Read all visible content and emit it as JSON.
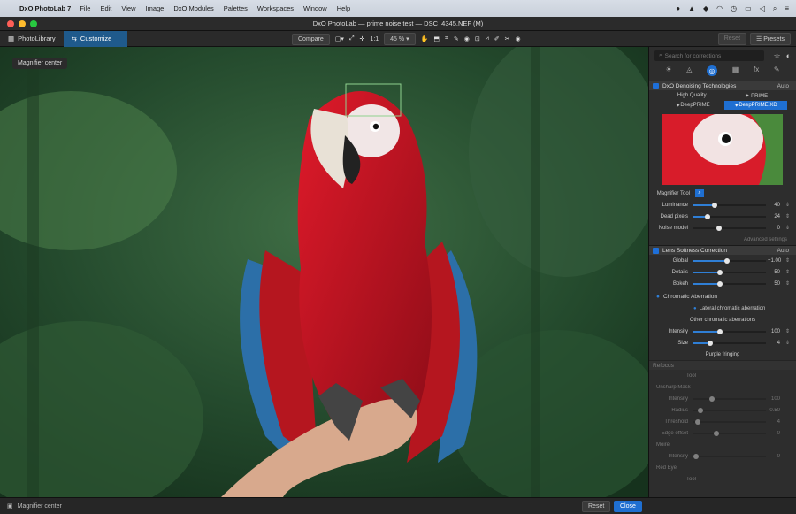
{
  "menubar": {
    "app": "DxO PhotoLab 7",
    "items": [
      "File",
      "Edit",
      "View",
      "Image",
      "DxO Modules",
      "Palettes",
      "Workspaces",
      "Window",
      "Help"
    ]
  },
  "window": {
    "title": "DxO PhotoLab — prime noise test — DSC_4345.NEF (M)"
  },
  "tabs": {
    "library": "PhotoLibrary",
    "customize": "Customize"
  },
  "toolbar": {
    "compare": "Compare",
    "ratio": "1:1",
    "zoom": "45 %",
    "reset": "Reset",
    "presets": "Presets"
  },
  "viewer": {
    "tooltip": "Magnifier center"
  },
  "panel": {
    "search_placeholder": "Search for corrections",
    "denoise": {
      "title": "DxO Denoising Technologies",
      "auto": "Auto",
      "hq": "High Quality",
      "prime": "PRIME",
      "deepprime": "DeepPRIME",
      "deepprimexd": "DeepPRIME XD",
      "magnifier": "Magnifier Tool",
      "luminance_label": "Luminance",
      "luminance": "40",
      "dead_label": "Dead pixels",
      "dead": "24",
      "noise_label": "Noise model",
      "noise": "0",
      "advanced": "Advanced settings"
    },
    "lens": {
      "title": "Lens Softness Correction",
      "auto": "Auto",
      "global_label": "Global",
      "global": "+1.00",
      "details_label": "Details",
      "details": "50",
      "bokeh_label": "Bokeh",
      "bokeh": "50"
    },
    "chroma": {
      "title": "Chromatic Aberration",
      "lateral": "Lateral chromatic aberration",
      "other": "Other chromatic aberrations",
      "intensity_label": "Intensity",
      "intensity": "100",
      "size_label": "Size",
      "size": "4",
      "purple": "Purple fringing"
    },
    "refocus": {
      "title": "Refocus",
      "tool": "Tool"
    },
    "unsharp": {
      "title": "Unsharp Mask",
      "intensity_label": "Intensity",
      "intensity": "100",
      "radius_label": "Radius",
      "radius": "0.50",
      "threshold_label": "Threshold",
      "threshold": "4",
      "edge_label": "Edge offset",
      "edge": "0"
    },
    "moire": {
      "title": "Moiré",
      "intensity_label": "Intensity",
      "intensity": "0"
    },
    "redeye": {
      "title": "Red Eye",
      "tool": "Tool"
    }
  },
  "status": {
    "left": "Magnifier center",
    "reset": "Reset",
    "close": "Close"
  },
  "colors": {
    "accent": "#1f5a8c",
    "slider": "#2f7fd6"
  }
}
